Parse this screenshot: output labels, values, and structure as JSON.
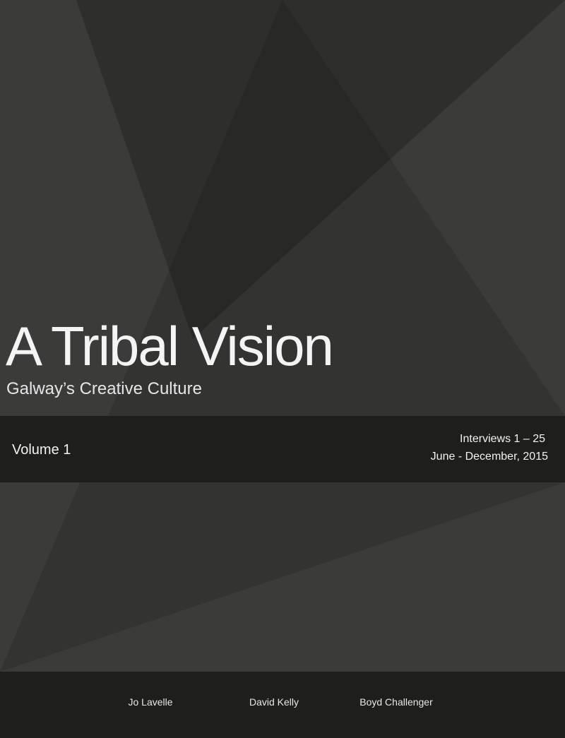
{
  "cover": {
    "title": "A Tribal Vision",
    "subtitle": "Galway’s Creative Culture",
    "volume": "Volume 1",
    "interviews": "Interviews 1 – 25",
    "dates": "June - December, 2015",
    "authors": [
      "Jo Lavelle",
      "David Kelly",
      "Boyd Challenger"
    ]
  },
  "colors": {
    "background": "#3b3b3a",
    "band": "#1e1e1d",
    "text": "#f2f2f2"
  }
}
